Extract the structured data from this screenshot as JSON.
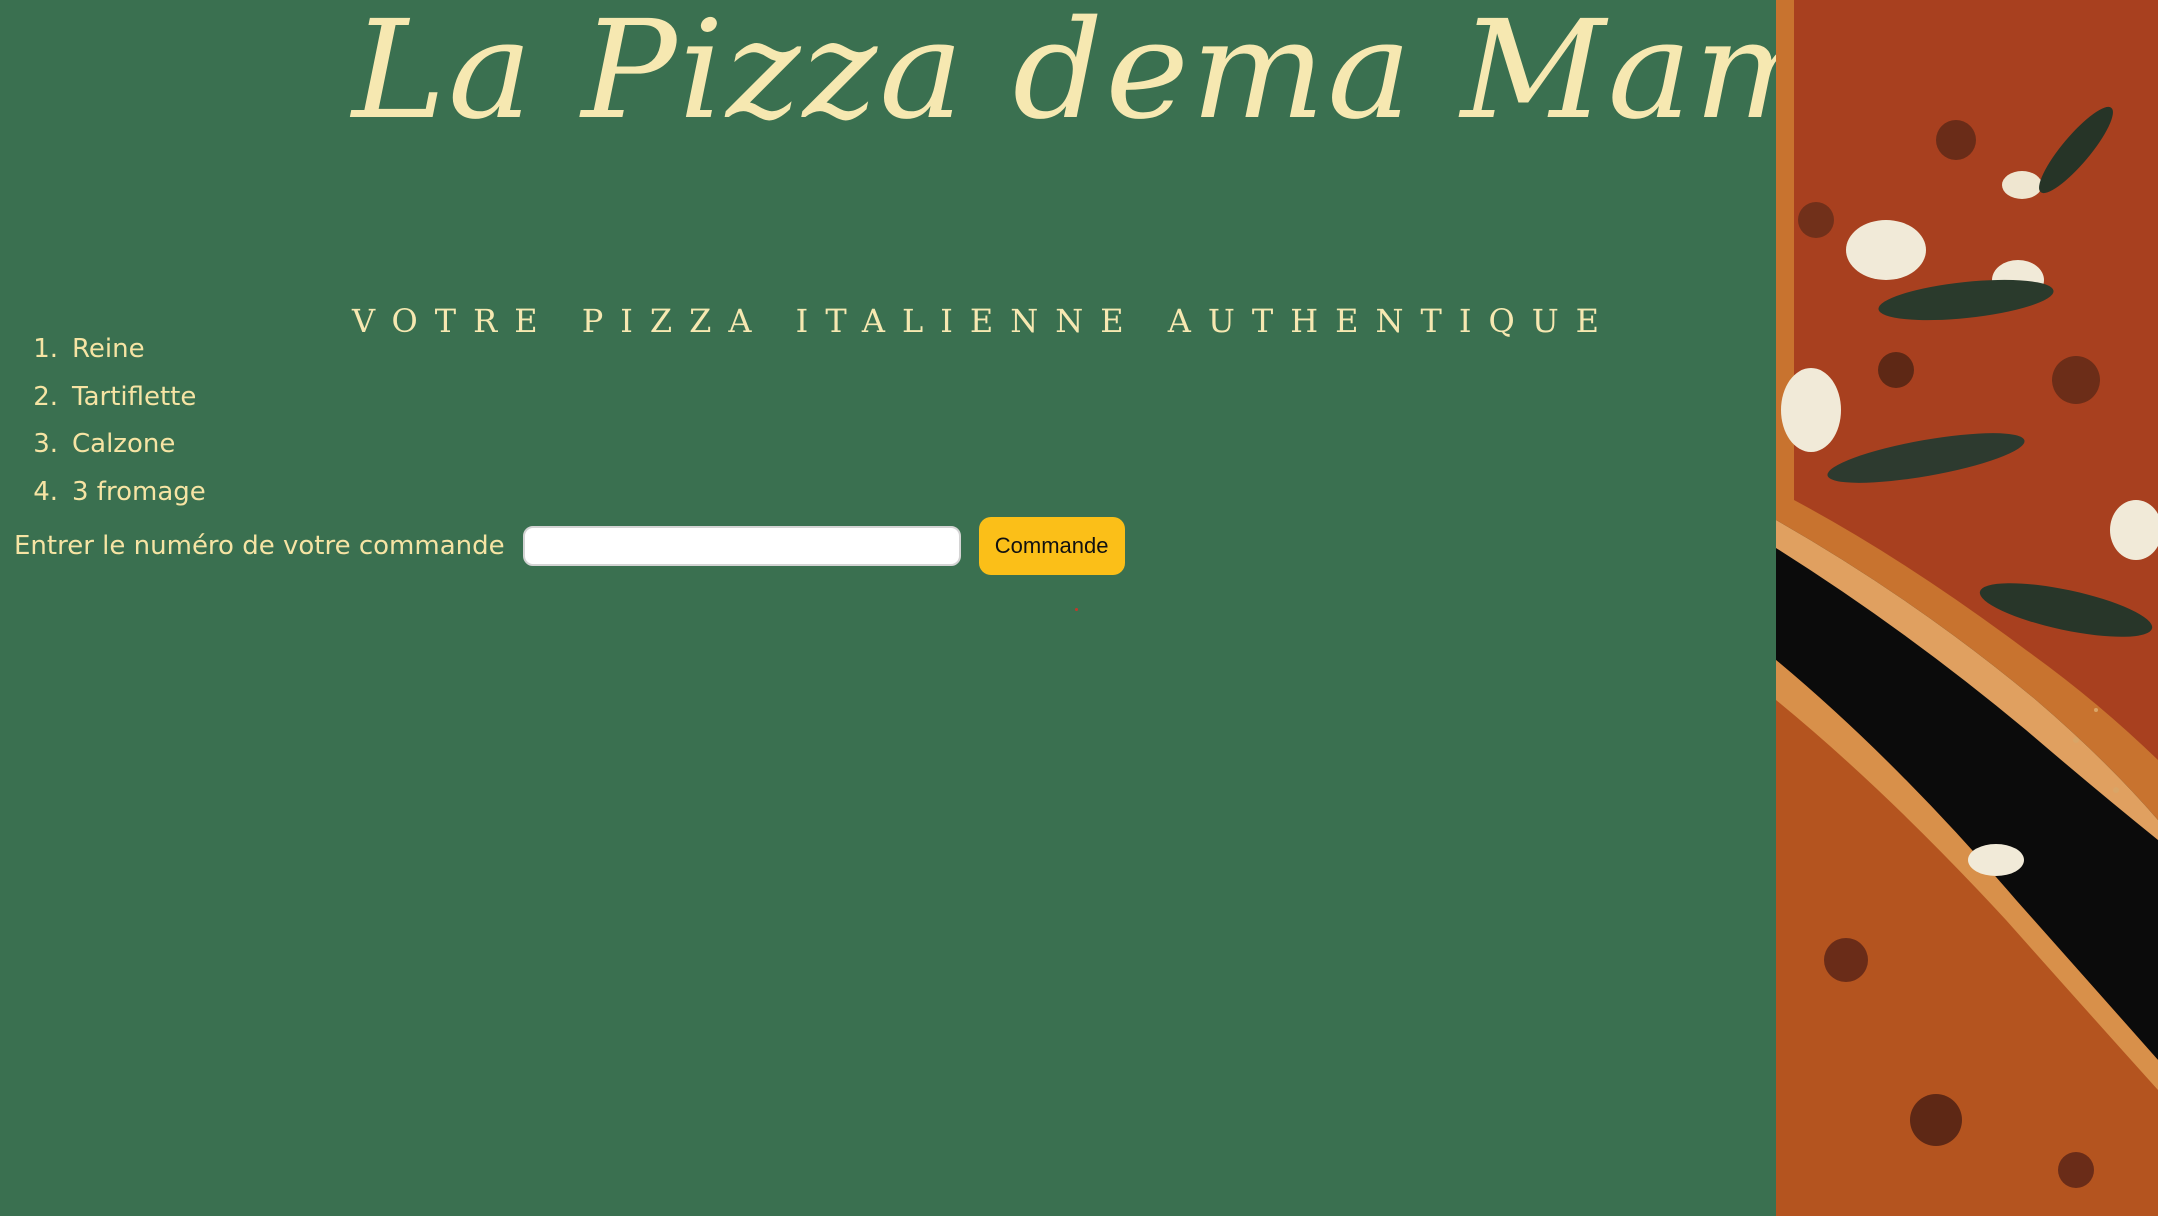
{
  "header": {
    "title": "La Pizza dema Mama",
    "tagline": "VOTRE PIZZA ITALIENNE AUTHENTIQUE"
  },
  "menu": {
    "items": [
      {
        "number": "1.",
        "name": "Reine"
      },
      {
        "number": "2.",
        "name": "Tartiflette"
      },
      {
        "number": "3.",
        "name": "Calzone"
      },
      {
        "number": "4.",
        "name": "3 fromage"
      }
    ]
  },
  "order": {
    "label": "Entrer le numéro de votre commande",
    "input_value": "",
    "button_label": "Commande"
  },
  "colors": {
    "background": "#3a7050",
    "text": "#f6e4a4",
    "button": "#fbbf18"
  },
  "hero_image": "pizza-photo"
}
